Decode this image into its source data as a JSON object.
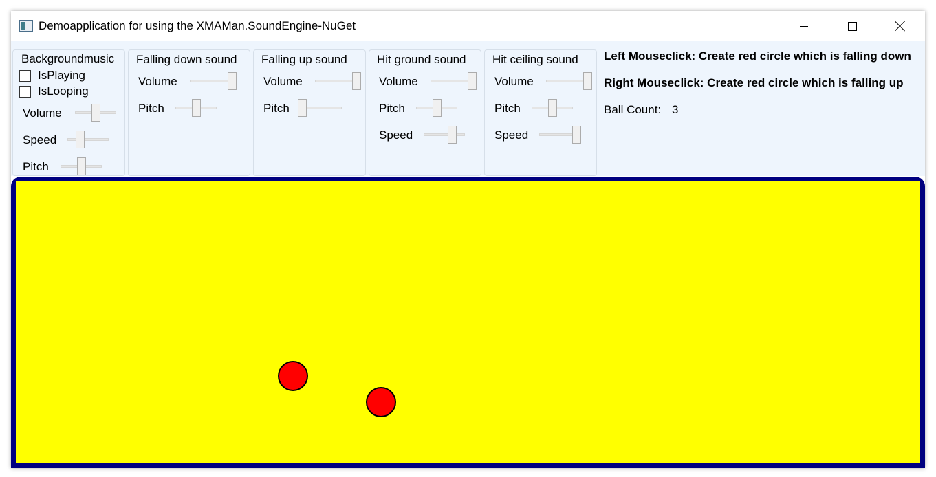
{
  "window": {
    "title": "Demoapplication for using the XMAMan.SoundEngine-NuGet",
    "minimize_icon": "minimize-icon",
    "maximize_icon": "maximize-icon",
    "close_icon": "close-icon"
  },
  "background_music": {
    "title": "Backgroundmusic",
    "is_playing_label": "IsPlaying",
    "is_playing": false,
    "is_looping_label": "IsLooping",
    "is_looping": false,
    "volume_label": "Volume",
    "volume": 0.5,
    "speed_label": "Speed",
    "speed": 0.25,
    "pitch_label": "Pitch",
    "pitch": 0.5
  },
  "falling_down_sound": {
    "title": "Falling down sound",
    "volume_label": "Volume",
    "volume": 1.0,
    "pitch_label": "Pitch",
    "pitch": 0.5
  },
  "falling_up_sound": {
    "title": "Falling up sound",
    "volume_label": "Volume",
    "volume": 1.0,
    "pitch_label": "Pitch",
    "pitch": 0.0
  },
  "hit_ground_sound": {
    "title": "Hit ground sound",
    "volume_label": "Volume",
    "volume": 1.0,
    "pitch_label": "Pitch",
    "pitch": 0.5,
    "speed_label": "Speed",
    "speed": 0.75
  },
  "hit_ceiling_sound": {
    "title": "Hit ceiling sound",
    "volume_label": "Volume",
    "volume": 1.0,
    "pitch_label": "Pitch",
    "pitch": 0.5,
    "speed_label": "Speed",
    "speed": 1.0
  },
  "info": {
    "left_click": "Left Mouseclick: Create red circle which is falling down",
    "right_click": "Right Mouseclick: Create red circle which is falling up",
    "ball_count_label": "Ball Count:",
    "ball_count": "3"
  },
  "colors": {
    "playfield_border": "#000080",
    "playfield_background": "#ffff00",
    "ball_fill": "#ff0000",
    "controls_background": "#eef5fd"
  }
}
